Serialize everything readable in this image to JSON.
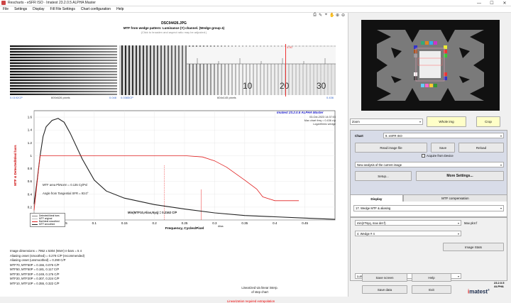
{
  "window": {
    "title": "Imatest 23.2.0.5 ALPHA Master",
    "app_title_full": "Rescharts - eSFR ISO · Imatest 23.2.0.5 ALPHA Master",
    "min": "—",
    "max": "☐",
    "close": "✕"
  },
  "menu": [
    "File",
    "Settings",
    "Display",
    "Fill File Settings",
    "Chart configuration",
    "Help"
  ],
  "plot": {
    "filename": "DSC04426.JPG",
    "subtitle": "MTF from wedge pattern:  Luminance (Y) channel.  (Wedge group 4)",
    "note": "(Click to broaden and aspect ratio may be adjusted.)",
    "wedge_red_label": "4.00",
    "ruler_numbers": [
      "10",
      "20",
      "30"
    ],
    "wedge1_caps": [
      "0.0192CP",
      "600x626 pixels",
      "0.048"
    ],
    "wedge2_caps": [
      "0.0383CP",
      "604x145 pixels",
      "0.436"
    ],
    "imatest_label": "Imatest 23.2.0.5  ALPHA Master",
    "date_lines": [
      "03-Oct-2023 14:37:03",
      "Max chart freq = 0.436 c/p",
      "Logarithmic wedge"
    ],
    "annotation_area": "MTF area PkNorm = 0.135 Cy/Pxl",
    "annotation_angle": "Angle from Tangential SFR = 93.0°",
    "annotation_alias": "Alias",
    "annotation_min": "Min(MTF10,Alias,Nyq) = 0.2162 C/P",
    "legend": [
      {
        "label": "Detected/Ideal bars",
        "color": "#888888"
      },
      {
        "label": "MTF original",
        "color": "#bbbbbb"
      },
      {
        "label": "Bar/Ideal smoothed",
        "color": "#e02020"
      },
      {
        "label": "MTF smoothed",
        "color": "#222222"
      }
    ]
  },
  "chart_data": {
    "type": "line",
    "xlabel": "Frequency, Cycles/Pixel",
    "ylabel": "MTF    &    Detected/Ideal bars",
    "xlim": [
      0.0,
      0.5
    ],
    "ylim": [
      0.0,
      1.7
    ],
    "x_ticks": [
      "0",
      "0.05",
      "0.1",
      "0.15",
      "0.2",
      "0.25",
      "0.3",
      "0.35",
      "0.4",
      "0.45"
    ],
    "y_ticks": [
      "0",
      "0.2",
      "0.4",
      "0.6",
      "0.8",
      "1",
      "1.2",
      "1.4",
      "1.6"
    ],
    "series": [
      {
        "name": "MTF smoothed",
        "color": "#222222",
        "x": [
          0.0,
          0.005,
          0.01,
          0.015,
          0.02,
          0.03,
          0.04,
          0.05,
          0.06,
          0.08,
          0.1,
          0.12,
          0.15,
          0.2,
          0.25,
          0.3,
          0.35,
          0.4,
          0.45,
          0.5
        ],
        "y": [
          0.25,
          0.6,
          1.0,
          1.3,
          1.45,
          1.55,
          1.58,
          1.52,
          1.35,
          0.95,
          0.62,
          0.45,
          0.34,
          0.24,
          0.17,
          0.11,
          0.07,
          0.05,
          0.03,
          0.01
        ]
      },
      {
        "name": "Bar/Ideal smoothed",
        "color": "#e02020",
        "x": [
          0.0,
          0.01,
          0.05,
          0.1,
          0.15,
          0.2,
          0.25,
          0.28,
          0.3,
          0.32,
          0.35,
          0.37,
          0.38,
          0.4,
          0.44
        ],
        "y": [
          0.15,
          1.0,
          1.0,
          1.0,
          1.0,
          1.0,
          1.0,
          0.98,
          0.92,
          0.82,
          0.62,
          0.48,
          0.36,
          0.3,
          0.3
        ]
      }
    ],
    "marker_x": 0.2162
  },
  "info": [
    "Image dimensions = 7952 x 5304 (WxH)   n-bars = 5   4",
    "Aliasing onset (smoothed) = 0.278 C/P (recommended)",
    "Aliasing onset (unsmoothed) = 0.290 C/P",
    "MTF70, MTF50P = 0.156, 0.076 C/P",
    "MTF50, MTF50P = 0.181, 0.117 C/P",
    "MTF30, MTF30P = 0.249, 0.176 C/P",
    "MTF20, MTF20P = 0.307, 0.224 C/P",
    "MTF10, MTF10P = 0.355, 0.322 C/P"
  ],
  "linear_caption": [
    "Linearized via linear interp.",
    "of step chart"
  ],
  "linear_required": "Linearization required extrapolation",
  "controls": {
    "zoom_value": "Zoom",
    "whole_img": "Whole img",
    "crop": "Crop",
    "chart_label": "Chart",
    "chart_value": "9. eSFR ISO",
    "read_image": "Read image file",
    "save": "Save",
    "reload": "Reload",
    "acquire": "Acquire from Device",
    "new_analysis": "New analysis of the current image",
    "setup": "Setup...",
    "more_settings": "More Settings...",
    "tab_display": "Display",
    "tab_mtf": "MTF compensation",
    "display_value": "17. Wedge MTF & aliasing",
    "plot1_value": "min(2*Nyq, max det f)",
    "plot1_label": "Max plot f",
    "wedge_value": "4. Wedge # 4",
    "image_stats": "Image Stats",
    "channel_value": "Luminance (Y) channel",
    "save_screen": "Save screen",
    "help": "Help",
    "save_data": "Save data",
    "exit": "Exit",
    "version": "23.2.0.5  ALPHA",
    "logo_a": "i",
    "logo_b": "matest",
    "logo_tm": "®"
  }
}
